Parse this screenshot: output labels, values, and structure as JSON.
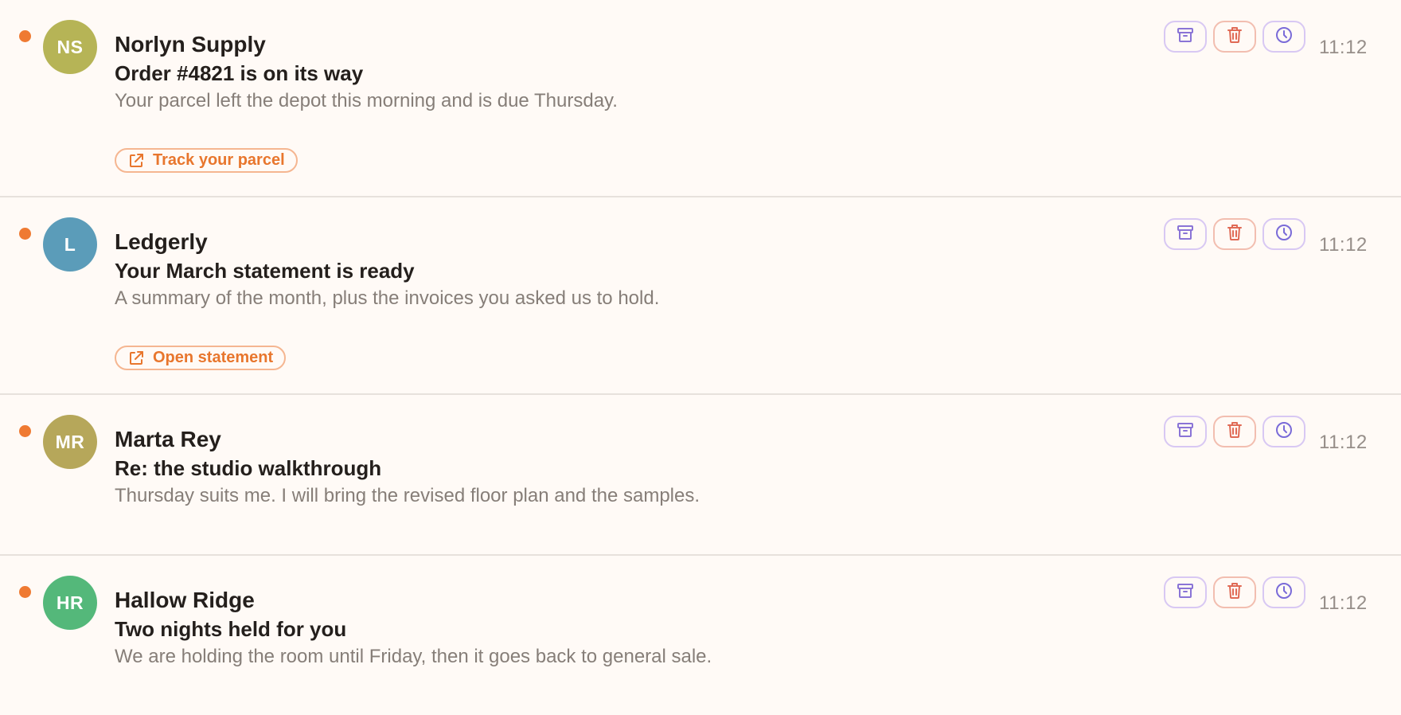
{
  "colors": {
    "unread": "#ef7a32",
    "link": "#e8762d",
    "archive_icon": "#8a74d6",
    "trash_icon": "#e06a55",
    "snooze_icon": "#7a6bd8"
  },
  "messages": [
    {
      "initials": "NS",
      "avatar_color": "#b6b456",
      "sender": "Norlyn Supply",
      "subject": "Order #4821 is on its way",
      "preview": "Your parcel left the depot this morning and is due Thursday.",
      "action": "Track your parcel",
      "time": "11:12",
      "unread": true
    },
    {
      "initials": "L",
      "avatar_color": "#5b9cb9",
      "sender": "Ledgerly",
      "subject": "Your March statement is ready",
      "preview": "A summary of the month, plus the invoices you asked us to hold.",
      "action": "Open statement",
      "time": "11:12",
      "unread": true
    },
    {
      "initials": "MR",
      "avatar_color": "#b6a75a",
      "sender": "Marta Rey",
      "subject": "Re: the studio walkthrough",
      "preview": "Thursday suits me. I will bring the revised floor plan and the samples.",
      "action": "",
      "time": "11:12",
      "unread": true
    },
    {
      "initials": "HR",
      "avatar_color": "#54b87a",
      "sender": "Hallow Ridge",
      "subject": "Two nights held for you",
      "preview": "We are holding the room until Friday, then it goes back to general sale.",
      "action": "",
      "time": "11:12",
      "unread": true
    }
  ],
  "icons": {
    "archive": "archive-icon",
    "trash": "trash-icon",
    "snooze": "clock-icon",
    "external": "external-link-icon"
  }
}
